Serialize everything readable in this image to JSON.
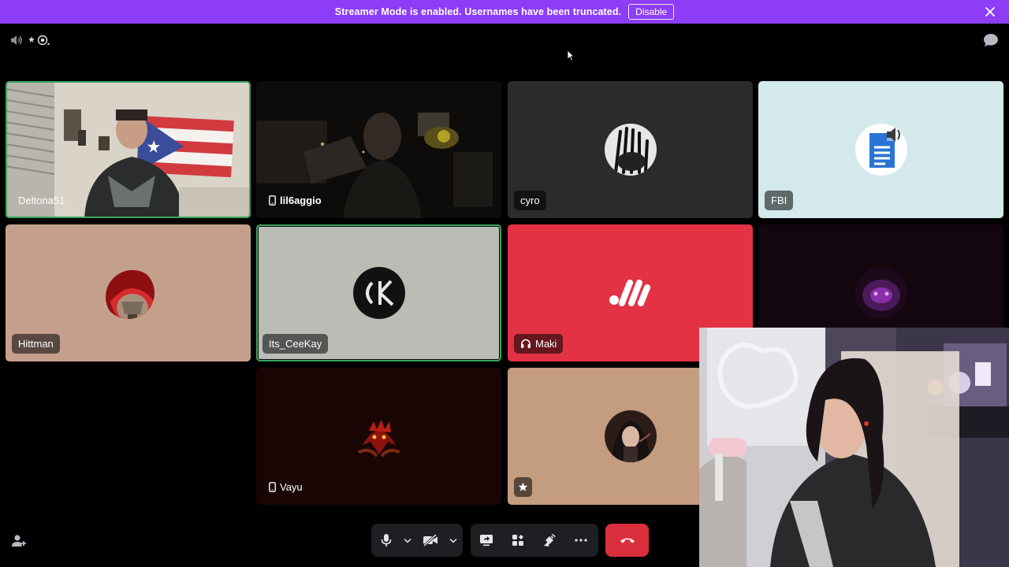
{
  "banner": {
    "message": "Streamer Mode is enabled. Usernames have been truncated.",
    "disable_label": "Disable",
    "color": "#8c3df5"
  },
  "topbar": {
    "left_icons": [
      "speaker-icon",
      "activity-icon"
    ],
    "right_icon": "chat-bubble-icon"
  },
  "tiles": [
    {
      "name": "Deltona51",
      "type": "video",
      "speaking": true
    },
    {
      "name": "lil6aggio",
      "type": "video",
      "mobile": true,
      "bold": true
    },
    {
      "name": "cyro",
      "type": "avatar",
      "bg": "#2b2b2b"
    },
    {
      "name": "FBI",
      "type": "avatar",
      "bg": "#d3e9ec"
    },
    {
      "name": "Hittman",
      "type": "avatar",
      "bg": "#c4a08c"
    },
    {
      "name": "Its_CeeKay",
      "type": "avatar",
      "bg": "#bcbcb7",
      "speaking": true
    },
    {
      "name": "Maki",
      "type": "avatar",
      "bg": "#e23244",
      "icon": "headset-icon"
    },
    {
      "name": "",
      "type": "avatar",
      "bg": "#14060f"
    },
    {
      "name": "Vayu",
      "type": "avatar",
      "bg": "#180504",
      "mobile": true
    },
    {
      "name": "",
      "type": "avatar",
      "bg": "#c49c80",
      "star": true
    }
  ],
  "controls": {
    "mic_icon": "microphone-icon",
    "camera_icon": "camera-off-icon",
    "share_icon": "screen-share-icon",
    "activities_icon": "activities-icon",
    "soundboard_icon": "soundboard-icon",
    "more_icon": "more-icon",
    "hangup_icon": "hang-up-icon",
    "invite_icon": "add-user-icon",
    "hangup_color": "#da2f3d"
  }
}
